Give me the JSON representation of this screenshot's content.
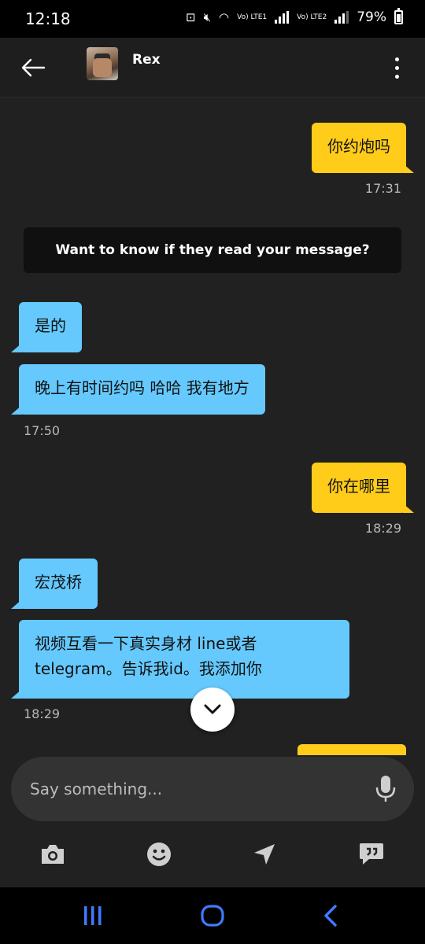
{
  "status_bar": {
    "time": "12:18",
    "battery_percent": "79%",
    "network_labels": [
      "Vo) LTE1",
      "Vo) LTE2"
    ]
  },
  "header": {
    "contact_name": "Rex"
  },
  "messages": [
    {
      "direction": "sent",
      "text": "你约炮吗"
    },
    {
      "direction": "received",
      "text": "是的"
    },
    {
      "direction": "received",
      "text": "晚上有时间约吗 哈哈  我有地方"
    },
    {
      "direction": "sent",
      "text": "你在哪里"
    },
    {
      "direction": "received",
      "text": "宏茂桥"
    },
    {
      "direction": "received",
      "text_line1": "视频互看一下真实身材  line或者",
      "text_line2": "telegram。告诉我id。我添加你"
    }
  ],
  "timestamps": [
    "17:31",
    "17:50",
    "18:29",
    "18:29"
  ],
  "read_receipt_prompt": "Want to know if they read your message?",
  "composer": {
    "placeholder": "Say something..."
  },
  "toolbar_icons": [
    "camera-icon",
    "smiley-icon",
    "location-icon",
    "saved-phrases-icon"
  ],
  "colors": {
    "sent_bubble": "#ffcc19",
    "received_bubble": "#65c9fe",
    "background": "#212121"
  }
}
